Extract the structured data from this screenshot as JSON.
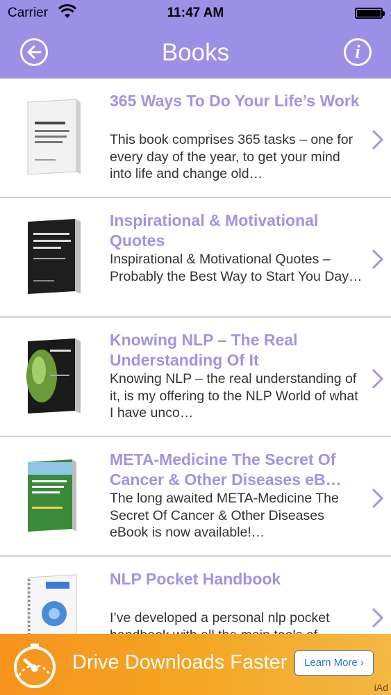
{
  "status": {
    "carrier": "Carrier",
    "time": "11:47 AM"
  },
  "nav": {
    "title": "Books",
    "info_glyph": "i"
  },
  "books": [
    {
      "title": "365 Ways To Do Your Life’s Work",
      "description": "This book comprises 365 tasks – one for every day of the year, to get your mind into life and change old…"
    },
    {
      "title": "Inspirational & Motivational Quotes",
      "description": "Inspirational & Motivational Quotes – Probably the Best Way to Start You Day…"
    },
    {
      "title": "Knowing NLP – The Real Understanding Of It",
      "description": "Knowing NLP – the real understanding of it, is my offering to the NLP World of what I have unco…"
    },
    {
      "title": "META-Medicine The Secret Of Cancer & Other Diseases eB…",
      "description": "The long awaited META-Medicine The Secret Of Cancer & Other Diseases eBook is now available!…"
    },
    {
      "title": "NLP Pocket Handbook",
      "description": "I’ve developed a personal nlp pocket handbook with all the main tools of…"
    }
  ],
  "ad": {
    "headline": "Drive Downloads Faster",
    "button": "Learn More",
    "label": "iAd"
  },
  "colors": {
    "header": "#9B8FE6",
    "title": "#A193E4",
    "ad": "#F5A623"
  },
  "icons": [
    "back-arrow-icon",
    "info-icon",
    "chevron-right-icon",
    "wifi-icon",
    "battery-icon",
    "speedometer-icon"
  ]
}
